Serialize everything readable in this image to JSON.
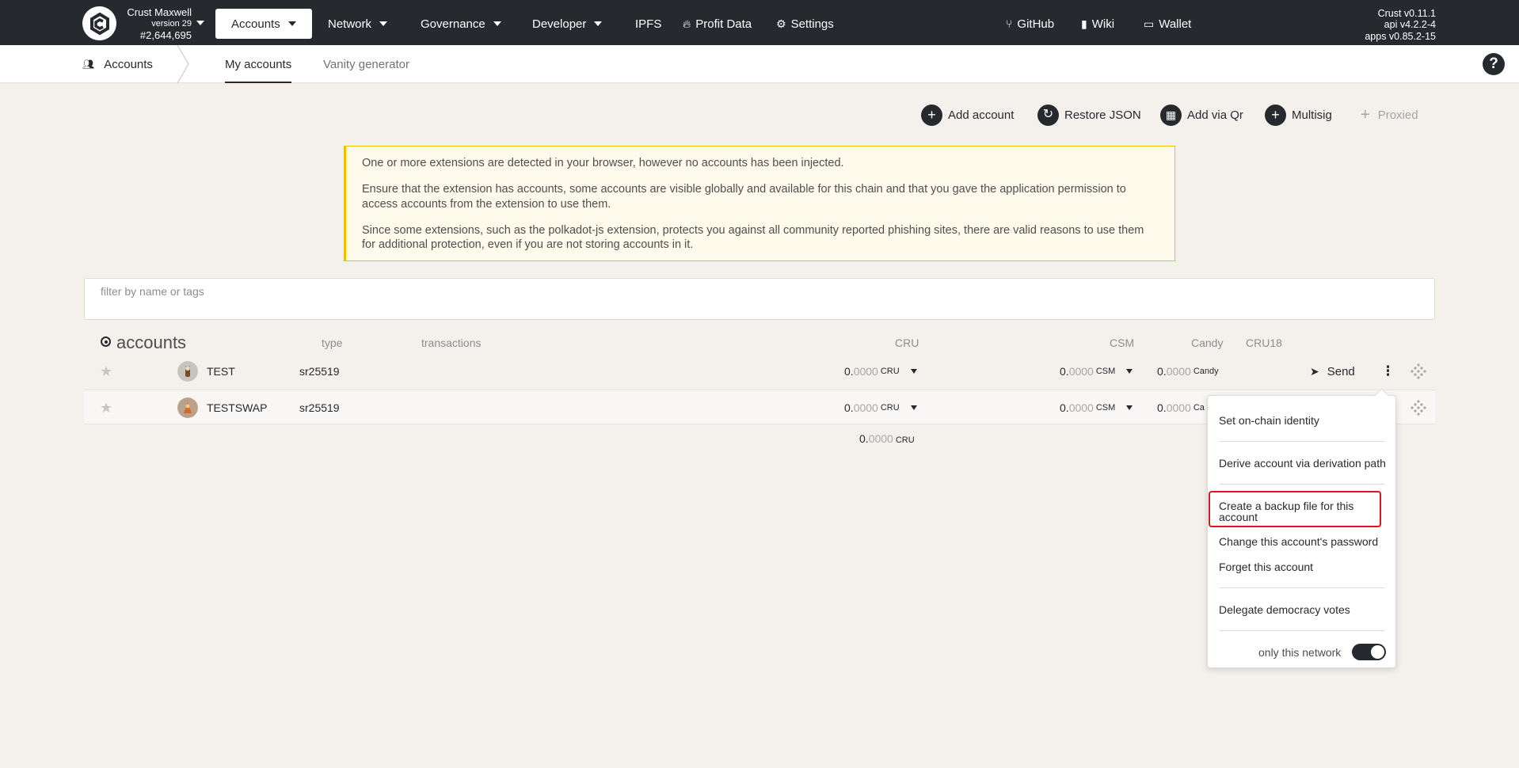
{
  "header": {
    "chain_name": "Crust Maxwell",
    "chain_version": "version 29",
    "block_number": "#2,644,695",
    "menus": [
      {
        "label": "Accounts"
      },
      {
        "label": "Network"
      },
      {
        "label": "Governance"
      },
      {
        "label": "Developer"
      },
      {
        "label": "IPFS"
      },
      {
        "label": "Profit Data"
      },
      {
        "label": "Settings"
      }
    ],
    "links": [
      {
        "label": "GitHub"
      },
      {
        "label": "Wiki"
      },
      {
        "label": "Wallet"
      }
    ],
    "versions": [
      "Crust v0.11.1",
      "api v4.2.2-4",
      "apps v0.85.2-15"
    ]
  },
  "subnav": {
    "section": "Accounts",
    "tabs": [
      {
        "label": "My accounts"
      },
      {
        "label": "Vanity generator"
      }
    ],
    "help": "?"
  },
  "actions": [
    {
      "label": "Add account",
      "icon": "+"
    },
    {
      "label": "Restore JSON",
      "icon": "↻"
    },
    {
      "label": "Add via Qr",
      "icon": "▦"
    },
    {
      "label": "Multisig",
      "icon": "+"
    },
    {
      "label": "Proxied",
      "icon": "+"
    }
  ],
  "warning": {
    "lines": [
      "One or more extensions are detected in your browser, however no accounts has been injected.",
      "Ensure that the extension has accounts, some accounts are visible globally and available for this chain and that you gave the application permission to access accounts from the extension to use them.",
      "Since some extensions, such as the polkadot-js extension, protects you against all community reported phishing sites, there are valid reasons to use them for additional protection, even if you are not storing accounts in it."
    ]
  },
  "filter": {
    "placeholder": "filter by name or tags"
  },
  "table": {
    "title": "accounts",
    "columns": {
      "type": "type",
      "transactions": "transactions",
      "cru": "CRU",
      "csm": "CSM",
      "candy": "Candy",
      "cru18": "CRU18"
    },
    "rows": [
      {
        "name": "TEST",
        "type": "sr25519",
        "cru_int": "0.",
        "cru_dec": "0000",
        "cru_unit": "CRU",
        "csm_int": "0.",
        "csm_dec": "0000",
        "csm_unit": "CSM",
        "candy_int": "0.",
        "candy_dec": "0000",
        "candy_unit": "Candy",
        "send": "Send"
      },
      {
        "name": "TESTSWAP",
        "type": "sr25519",
        "cru_int": "0.",
        "cru_dec": "0000",
        "cru_unit": "CRU",
        "csm_int": "0.",
        "csm_dec": "0000",
        "csm_unit": "CSM",
        "candy_int": "0.",
        "candy_dec": "0000",
        "candy_unit": "Ca"
      }
    ],
    "total": {
      "int": "0.",
      "dec": "0000",
      "unit": "CRU"
    }
  },
  "dropdown": {
    "items": [
      "Set on-chain identity",
      "Derive account via derivation path",
      "Create a backup file for this account",
      "Change this account's password",
      "Forget this account",
      "Delegate democracy votes"
    ],
    "toggle_label": "only this network",
    "toggle_on": true
  },
  "colors": {
    "header_bg": "#26292e",
    "page_bg": "#f4f1ed",
    "warning_border": "#f0c000",
    "highlight": "#e0141e"
  }
}
